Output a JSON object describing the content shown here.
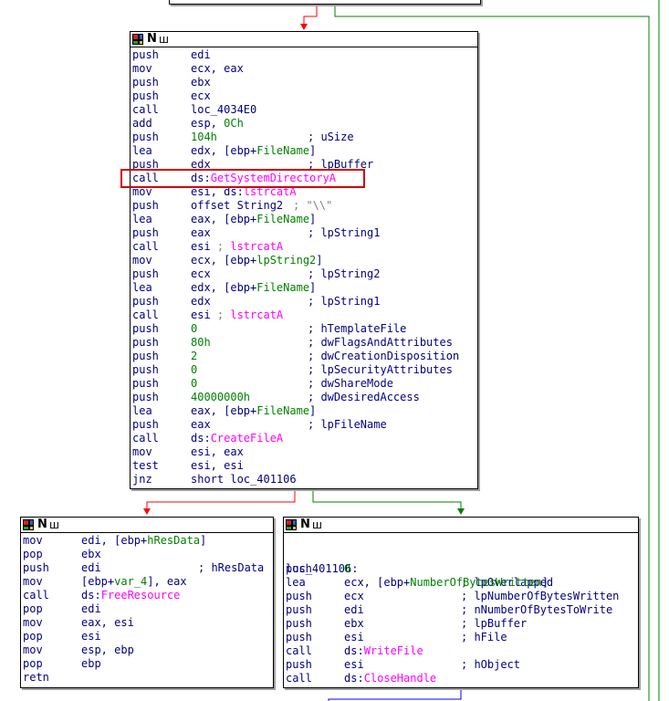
{
  "colors": {
    "edge_false": "#ff0000",
    "edge_true": "#008000",
    "edge_out": "#0000ff",
    "highlight_border": "#d00000",
    "highlight_fill": "#ffff80"
  },
  "header_icons": [
    "graph-icon",
    "name-icon",
    "xref-icon"
  ],
  "node_main": {
    "lines": [
      [
        {
          "t": "push"
        },
        {
          "t": "edi"
        }
      ],
      [
        {
          "t": "mov"
        },
        {
          "t": "ecx, eax"
        }
      ],
      [
        {
          "t": "push"
        },
        {
          "t": "ebx"
        }
      ],
      [
        {
          "t": "push"
        },
        {
          "t": "ecx"
        }
      ],
      [
        {
          "t": "call"
        },
        {
          "t": "loc_4034E0"
        }
      ],
      [
        {
          "t": "add"
        },
        {
          "t": "esp, ",
          "x": "0Ch"
        }
      ],
      [
        {
          "t": "push"
        },
        {
          "g": "104h"
        },
        {
          "c": "; uSize"
        }
      ],
      [
        {
          "t": "lea"
        },
        {
          "t": "edx, [ebp+",
          "x": "FileName",
          "e": "]"
        }
      ],
      [
        {
          "t": "push"
        },
        {
          "t": "edx"
        },
        {
          "c": "; lpBuffer"
        }
      ],
      [
        {
          "t": "call"
        },
        {
          "t": "ds:",
          "p": "GetSystemDirectoryA"
        }
      ],
      [
        {
          "t": "mov"
        },
        {
          "t": "esi, ds:",
          "p": "lstrcatA"
        }
      ],
      [
        {
          "t": "push"
        },
        {
          "t": "offset String2"
        },
        {
          "gc": "; \"\\\\\""
        }
      ],
      [
        {
          "t": "lea"
        },
        {
          "t": "eax, [ebp+",
          "x": "FileName",
          "e": "]"
        }
      ],
      [
        {
          "t": "push"
        },
        {
          "t": "eax"
        },
        {
          "c": "; lpString1"
        }
      ],
      [
        {
          "t": "call"
        },
        {
          "t": "esi ",
          "p2": "; ",
          "p": "lstrcatA"
        }
      ],
      [
        {
          "t": "mov"
        },
        {
          "t": "ecx, [ebp+",
          "x": "lpString2",
          "e": "]"
        }
      ],
      [
        {
          "t": "push"
        },
        {
          "t": "ecx"
        },
        {
          "c": "; lpString2"
        }
      ],
      [
        {
          "t": "lea"
        },
        {
          "t": "edx, [ebp+",
          "x": "FileName",
          "e": "]"
        }
      ],
      [
        {
          "t": "push"
        },
        {
          "t": "edx"
        },
        {
          "c": "; lpString1"
        }
      ],
      [
        {
          "t": "call"
        },
        {
          "t": "esi ",
          "p2": "; ",
          "p": "lstrcatA"
        }
      ],
      [
        {
          "t": "push"
        },
        {
          "g": "0"
        },
        {
          "c": "; hTemplateFile"
        }
      ],
      [
        {
          "t": "push"
        },
        {
          "g": "80h"
        },
        {
          "c": "; dwFlagsAndAttributes"
        }
      ],
      [
        {
          "t": "push"
        },
        {
          "g": "2"
        },
        {
          "c": "; dwCreationDisposition"
        }
      ],
      [
        {
          "t": "push"
        },
        {
          "g": "0"
        },
        {
          "c": "; lpSecurityAttributes"
        }
      ],
      [
        {
          "t": "push"
        },
        {
          "g": "0"
        },
        {
          "c": "; dwShareMode"
        }
      ],
      [
        {
          "t": "push"
        },
        {
          "g": "40000000h"
        },
        {
          "c": "; dwDesiredAccess"
        }
      ],
      [
        {
          "t": "lea"
        },
        {
          "t": "eax, [ebp+",
          "x": "FileName",
          "e": "]"
        }
      ],
      [
        {
          "t": "push"
        },
        {
          "t": "eax"
        },
        {
          "c": "; lpFileName"
        }
      ],
      [
        {
          "t": "call"
        },
        {
          "t": "ds:",
          "p": "CreateFileA"
        }
      ],
      [
        {
          "t": "mov"
        },
        {
          "t": "esi, eax"
        }
      ],
      [
        {
          "t": "test"
        },
        {
          "t": "esi, esi"
        }
      ],
      [
        {
          "t": "jnz"
        },
        {
          "t": "short loc_401106"
        }
      ]
    ]
  },
  "node_left": {
    "lines": [
      [
        {
          "t": "mov"
        },
        {
          "t": "edi, [ebp+",
          "x": "hResData",
          "e": "]"
        }
      ],
      [
        {
          "t": "pop"
        },
        {
          "t": "ebx"
        }
      ],
      [
        {
          "t": "push"
        },
        {
          "t": "edi"
        },
        {
          "c": "; hResData"
        }
      ],
      [
        {
          "t": "mov"
        },
        {
          "t": "[ebp+",
          "x": "var_4",
          "e": "], eax"
        }
      ],
      [
        {
          "t": "call"
        },
        {
          "t": "ds:",
          "p": "FreeResource"
        }
      ],
      [
        {
          "t": "pop"
        },
        {
          "t": "edi"
        }
      ],
      [
        {
          "t": "mov"
        },
        {
          "t": "eax, esi"
        }
      ],
      [
        {
          "t": "pop"
        },
        {
          "t": "esi"
        }
      ],
      [
        {
          "t": "mov"
        },
        {
          "t": "esp, ebp"
        }
      ],
      [
        {
          "t": "pop"
        },
        {
          "t": "ebp"
        }
      ],
      [
        {
          "t": "retn"
        }
      ]
    ]
  },
  "node_right": {
    "label": "loc_401106:",
    "label_comment": "; lpOverlapped",
    "lines": [
      [
        {
          "t": "push"
        },
        {
          "g": "0"
        }
      ],
      [
        {
          "t": "lea"
        },
        {
          "t": "ecx, [ebp+",
          "x": "NumberOfBytesWritten",
          "e": "]"
        }
      ],
      [
        {
          "t": "push"
        },
        {
          "t": "ecx"
        },
        {
          "c": "; lpNumberOfBytesWritten"
        }
      ],
      [
        {
          "t": "push"
        },
        {
          "t": "edi"
        },
        {
          "c": "; nNumberOfBytesToWrite"
        }
      ],
      [
        {
          "t": "push"
        },
        {
          "t": "ebx"
        },
        {
          "c": "; lpBuffer"
        }
      ],
      [
        {
          "t": "push"
        },
        {
          "t": "esi"
        },
        {
          "c": "; hFile"
        }
      ],
      [
        {
          "t": "call"
        },
        {
          "t": "ds:",
          "p": "WriteFile"
        }
      ],
      [
        {
          "t": "push"
        },
        {
          "t": "esi"
        },
        {
          "c": "; hObject"
        }
      ],
      [
        {
          "t": "call"
        },
        {
          "t": "ds:",
          "p": "CloseHandle"
        }
      ]
    ]
  }
}
